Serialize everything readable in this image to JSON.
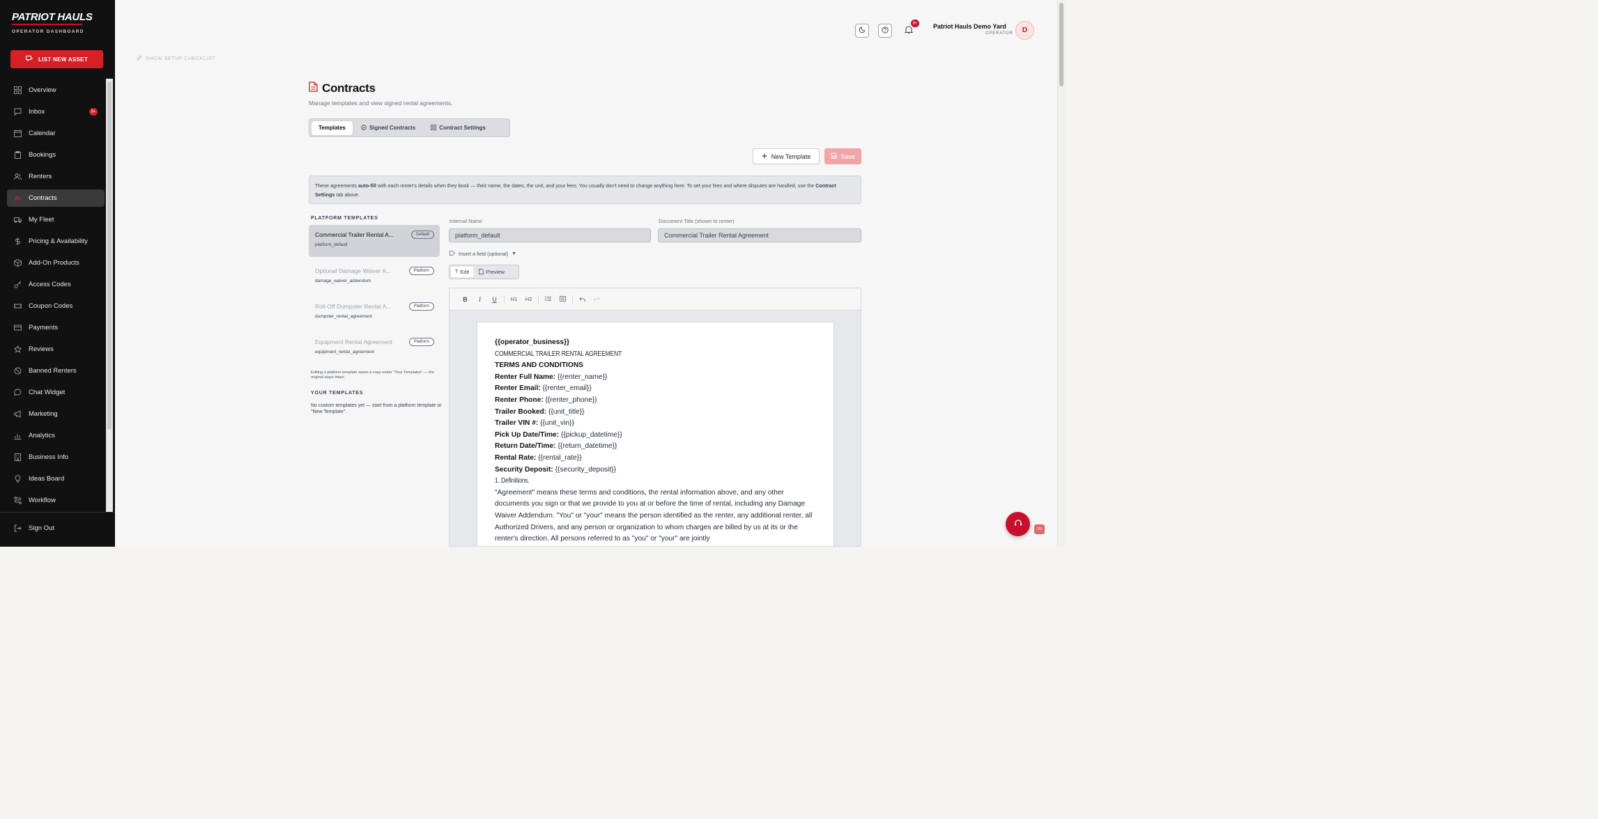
{
  "brand": {
    "name": "PATRIOT HAULS",
    "subtitle": "OPERATOR DASHBOARD",
    "accent": "#c8102e"
  },
  "sidebar": {
    "cta": "LIST NEW ASSET",
    "items": [
      {
        "label": "Overview",
        "icon": "grid-icon"
      },
      {
        "label": "Inbox",
        "icon": "message-icon",
        "badge": "9+"
      },
      {
        "label": "Calendar",
        "icon": "calendar-icon"
      },
      {
        "label": "Bookings",
        "icon": "clipboard-icon"
      },
      {
        "label": "Renters",
        "icon": "users-icon"
      },
      {
        "label": "Contracts",
        "icon": "signature-icon",
        "active": true
      },
      {
        "label": "My Fleet",
        "icon": "truck-icon"
      },
      {
        "label": "Pricing & Availability",
        "icon": "dollar-icon"
      },
      {
        "label": "Add-On Products",
        "icon": "box-icon"
      },
      {
        "label": "Access Codes",
        "icon": "key-icon"
      },
      {
        "label": "Coupon Codes",
        "icon": "ticket-icon"
      },
      {
        "label": "Payments",
        "icon": "card-icon"
      },
      {
        "label": "Reviews",
        "icon": "star-icon"
      },
      {
        "label": "Banned Renters",
        "icon": "ban-icon"
      },
      {
        "label": "Chat Widget",
        "icon": "chat-icon"
      },
      {
        "label": "Marketing",
        "icon": "megaphone-icon"
      },
      {
        "label": "Analytics",
        "icon": "chart-icon"
      },
      {
        "label": "Business Info",
        "icon": "building-icon"
      },
      {
        "label": "Ideas Board",
        "icon": "lightbulb-icon"
      },
      {
        "label": "Workflow",
        "icon": "workflow-icon"
      }
    ],
    "signout": "Sign Out"
  },
  "header": {
    "notifications_badge": "9+",
    "user_name": "Patriot Hauls Demo Yard",
    "user_role": "OPERATOR",
    "avatar_initial": "D",
    "setup_checklist": "SHOW SETUP CHECKLIST"
  },
  "page": {
    "title": "Contracts",
    "subtitle": "Manage templates and view signed rental agreements.",
    "tabs": [
      "Templates",
      "Signed Contracts",
      "Contract Settings"
    ],
    "new_template": "New Template",
    "save": "Save",
    "info": {
      "part1": "These agreements ",
      "bold1": "auto-fill",
      "part2": " with each renter's details when they book — their name, the dates, the unit, and your fees. You usually don't need to change anything here. To set your fees and where disputes are handled, use the ",
      "bold2": "Contract Settings",
      "part3": " tab above."
    }
  },
  "templates": {
    "platform_heading": "PLATFORM TEMPLATES",
    "items": [
      {
        "name": "Commercial Trailer Rental A...",
        "tag": "Default",
        "key": "platform_default",
        "active": true
      },
      {
        "name": "Optional Damage Waiver A...",
        "tag": "Platform",
        "key": "damage_waiver_addendum"
      },
      {
        "name": "Roll-Off Dumpster Rental A...",
        "tag": "Platform",
        "key": "dumpster_rental_agreement"
      },
      {
        "name": "Equipment Rental Agreement",
        "tag": "Platform",
        "key": "equipment_rental_agreement"
      }
    ],
    "edit_note": "Editing a platform template saves a copy under \"Your Templates\" — the original stays intact.",
    "your_heading": "YOUR TEMPLATES",
    "your_empty": "No custom templates yet — start from a platform template or \"New Template\"."
  },
  "editor": {
    "internal_name_label": "Internal Name",
    "internal_name_value": "platform_default",
    "doc_title_label": "Document Title (shown to renter)",
    "doc_title_value": "Commercial Trailer Rental Agreement",
    "insert_field": "Insert a field (optional)",
    "modes": [
      "Edit",
      "Preview"
    ],
    "toolbar": {
      "bold": "B",
      "italic": "I",
      "underline": "U",
      "h1": "H1",
      "h2": "H2"
    },
    "doc": {
      "line1": "{{operator_business}}",
      "line2": "COMMERCIAL TRAILER RENTAL AGREEMENT",
      "line3": "TERMS AND CONDITIONS",
      "fields": [
        {
          "label": "Renter Full Name:",
          "value": " {{renter_name}}"
        },
        {
          "label": "Renter Email:",
          "value": " {{renter_email}}"
        },
        {
          "label": "Renter Phone:",
          "value": " {{renter_phone}}"
        },
        {
          "label": "Trailer Booked:",
          "value": " {{unit_title}}"
        },
        {
          "label": "Trailer VIN #:",
          "value": " {{unit_vin}}"
        },
        {
          "label": "Pick Up Date/Time:",
          "value": " {{pickup_datetime}}"
        },
        {
          "label": "Return Date/Time:",
          "value": " {{return_datetime}}"
        },
        {
          "label": "Rental Rate:",
          "value": " {{rental_rate}}"
        },
        {
          "label": "Security Deposit:",
          "value": " {{security_deposit}}"
        }
      ],
      "section": "1. Definitions.",
      "body": "\"Agreement\" means these terms and conditions, the rental information above, and any other documents you sign or that we provide to you at or before the time of rental, including any Damage Waiver Addendum. \"You\" or \"your\" means the person identified as the renter, any additional renter, all Authorized Drivers, and any person or organization to whom charges are billed by us at its or the renter's direction. All persons referred to as \"you\" or \"your\" are jointly"
    }
  },
  "floating": {
    "mini_label": "3/5"
  }
}
